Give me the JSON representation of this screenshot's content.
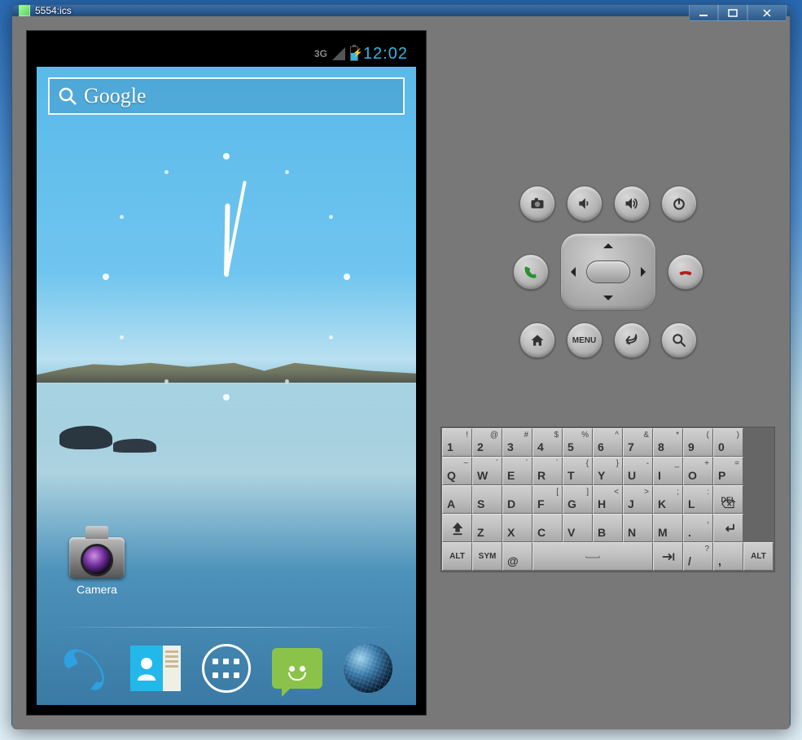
{
  "window": {
    "title": "5554:ics"
  },
  "status_bar": {
    "network": "3G",
    "time": "12:02"
  },
  "search": {
    "label": "Google"
  },
  "home_icons": {
    "camera": "Camera"
  },
  "hw_buttons": {
    "menu": "MENU"
  },
  "keyboard": {
    "row1": [
      {
        "main": "1",
        "sup": "!"
      },
      {
        "main": "2",
        "sup": "@"
      },
      {
        "main": "3",
        "sup": "#"
      },
      {
        "main": "4",
        "sup": "$"
      },
      {
        "main": "5",
        "sup": "%"
      },
      {
        "main": "6",
        "sup": "^"
      },
      {
        "main": "7",
        "sup": "&"
      },
      {
        "main": "8",
        "sup": "*"
      },
      {
        "main": "9",
        "sup": "("
      },
      {
        "main": "0",
        "sup": ")"
      }
    ],
    "row2": [
      {
        "main": "Q",
        "sup": "~"
      },
      {
        "main": "W",
        "sup": "`"
      },
      {
        "main": "E",
        "sup": "´"
      },
      {
        "main": "R",
        "sup": "`"
      },
      {
        "main": "T",
        "sup": "{"
      },
      {
        "main": "Y",
        "sup": "}"
      },
      {
        "main": "U",
        "sup": "-"
      },
      {
        "main": "I",
        "sup": "_"
      },
      {
        "main": "O",
        "sup": "+"
      },
      {
        "main": "P",
        "sup": "="
      }
    ],
    "row3": [
      {
        "main": "A",
        "sup": ""
      },
      {
        "main": "S",
        "sup": ""
      },
      {
        "main": "D",
        "sup": ""
      },
      {
        "main": "F",
        "sup": "["
      },
      {
        "main": "G",
        "sup": "]"
      },
      {
        "main": "H",
        "sup": "<"
      },
      {
        "main": "J",
        "sup": ">"
      },
      {
        "main": "K",
        "sup": ";"
      },
      {
        "main": "L",
        "sup": ":"
      }
    ],
    "row3_del": "DEL",
    "row4": [
      {
        "main": "Z",
        "sup": ""
      },
      {
        "main": "X",
        "sup": ""
      },
      {
        "main": "C",
        "sup": ""
      },
      {
        "main": "V",
        "sup": ""
      },
      {
        "main": "B",
        "sup": ""
      },
      {
        "main": "N",
        "sup": ""
      },
      {
        "main": "M",
        "sup": ""
      },
      {
        "main": ".",
        "sup": ","
      }
    ],
    "row5": {
      "alt_l": "ALT",
      "sym": "SYM",
      "at": "@",
      "comma": ",",
      "slash": "/",
      "q": "?",
      "alt_r": "ALT"
    }
  }
}
